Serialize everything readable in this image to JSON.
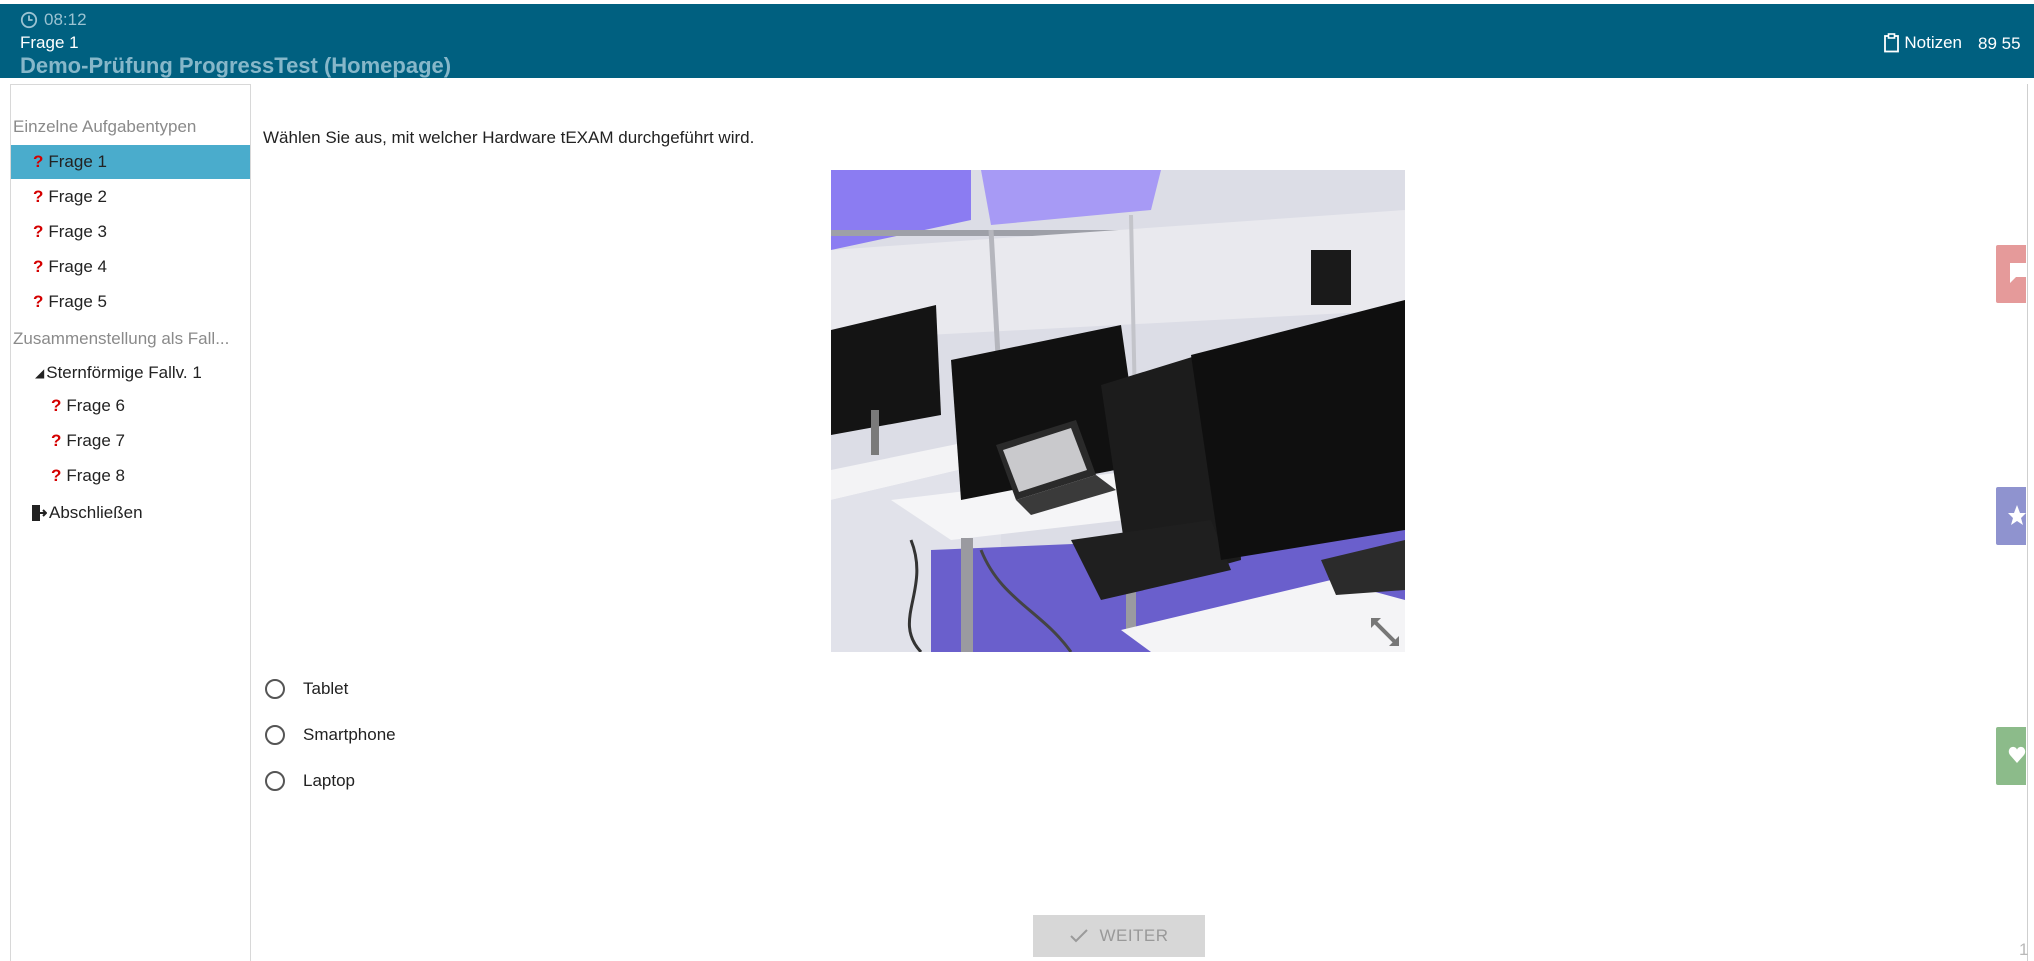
{
  "header": {
    "timer": "08:12",
    "question_label": "Frage 1",
    "exam_title": "Demo-Prüfung ProgressTest (Homepage)",
    "notes_label": "Notizen",
    "score": "89 55"
  },
  "sidebar": {
    "section1": "Einzelne Aufgabentypen",
    "items": [
      {
        "mark": "?",
        "label": "Frage 1"
      },
      {
        "mark": "?",
        "label": "Frage 2"
      },
      {
        "mark": "?",
        "label": "Frage 3"
      },
      {
        "mark": "?",
        "label": "Frage 4"
      },
      {
        "mark": "?",
        "label": "Frage 5"
      }
    ],
    "section2": "Zusammenstellung als Fall...",
    "group_label": "Sternförmige Fallv. 1",
    "group_items": [
      {
        "mark": "?",
        "label": "Frage 6"
      },
      {
        "mark": "?",
        "label": "Frage 7"
      },
      {
        "mark": "?",
        "label": "Frage 8"
      }
    ],
    "finish_label": "Abschließen",
    "active_index": 0
  },
  "main": {
    "question_text": "Wählen Sie aus, mit welcher Hardware tEXAM durchgeführt wird.",
    "options": [
      "Tablet",
      "Smartphone",
      "Laptop"
    ],
    "next_label": "WEITER"
  },
  "corner_number": "1",
  "colors": {
    "header_bg": "#006080",
    "active_item": "#4aaccc",
    "question_mark": "#d40000",
    "tab_red": "#e59a9a",
    "tab_purple": "#8f93cf",
    "tab_green": "#8cbb8a"
  },
  "icons": {
    "timer": "clock-icon",
    "notes": "clipboard-icon",
    "finish": "exit-door-icon",
    "expand": "expand-arrows-icon",
    "tab1": "comment-icon",
    "tab2": "star-icon",
    "tab3": "heart-icon",
    "next": "checkmark-icon"
  }
}
